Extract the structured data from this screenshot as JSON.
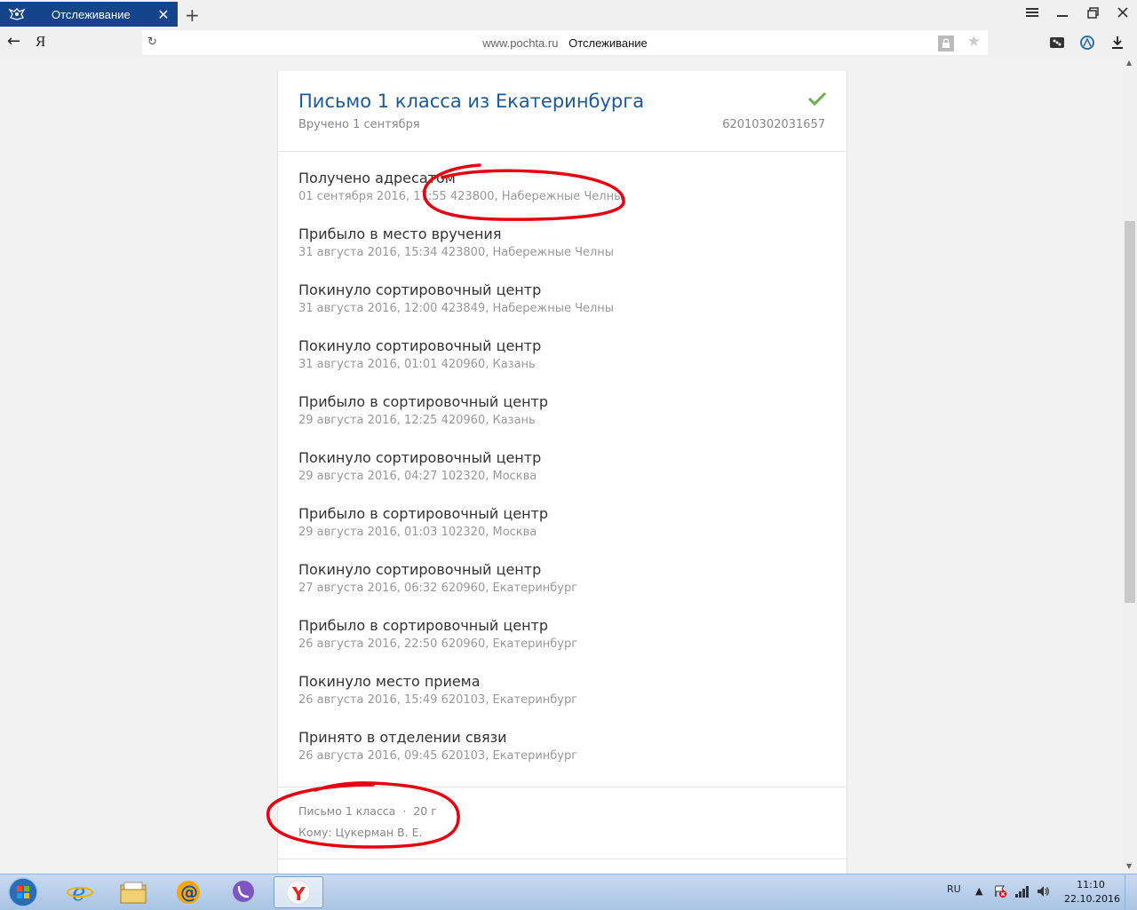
{
  "browser": {
    "tab_title": "Отслеживание",
    "close_glyph": "✕",
    "newtab_glyph": "+",
    "back_glyph": "←",
    "yandex_glyph": "Я",
    "reload_glyph": "↻",
    "address_domain": "www.pochta.ru",
    "address_page": "Отслеживание",
    "star_glyph": "★"
  },
  "item": {
    "title": "Письмо 1 класса из Екатеринбурга",
    "status": "Вручено 1 сентября",
    "tracking_number": "62010302031657",
    "status_color": "#6ab04c",
    "events": [
      {
        "title": "Получено адресатом",
        "meta": "01 сентября 2016, 17:55 423800, Набережные Челны"
      },
      {
        "title": "Прибыло в место вручения",
        "meta": "31 августа 2016, 15:34 423800, Набережные Челны"
      },
      {
        "title": "Покинуло сортировочный центр",
        "meta": "31 августа 2016, 12:00 423849, Набережные Челны"
      },
      {
        "title": "Покинуло сортировочный центр",
        "meta": "31 августа 2016, 01:01 420960, Казань"
      },
      {
        "title": "Прибыло в сортировочный центр",
        "meta": "29 августа 2016, 12:25 420960, Казань"
      },
      {
        "title": "Покинуло сортировочный центр",
        "meta": "29 августа 2016, 04:27 102320, Москва"
      },
      {
        "title": "Прибыло в сортировочный центр",
        "meta": "29 августа 2016, 01:03 102320, Москва"
      },
      {
        "title": "Покинуло сортировочный центр",
        "meta": "27 августа 2016, 06:32 620960, Екатеринбург"
      },
      {
        "title": "Прибыло в сортировочный центр",
        "meta": "26 августа 2016, 22:50 620960, Екатеринбург"
      },
      {
        "title": "Покинуло место приема",
        "meta": "26 августа 2016, 15:49 620103, Екатеринбург"
      },
      {
        "title": "Принято в отделении связи",
        "meta": "26 августа 2016, 09:45 620103, Екатеринбург"
      }
    ],
    "footer": {
      "type": "Письмо 1 класса",
      "separator": "·",
      "weight": "20 г",
      "recipient": "Кому: Цукерман В. Е."
    }
  },
  "annotation_color": "#e8000f",
  "taskbar": {
    "lang": "RU",
    "time": "11:10",
    "date": "22.10.2016",
    "apps": [
      "windows-start",
      "internet-explorer",
      "file-explorer",
      "mail-ru-agent",
      "viber",
      "yandex-browser"
    ]
  }
}
